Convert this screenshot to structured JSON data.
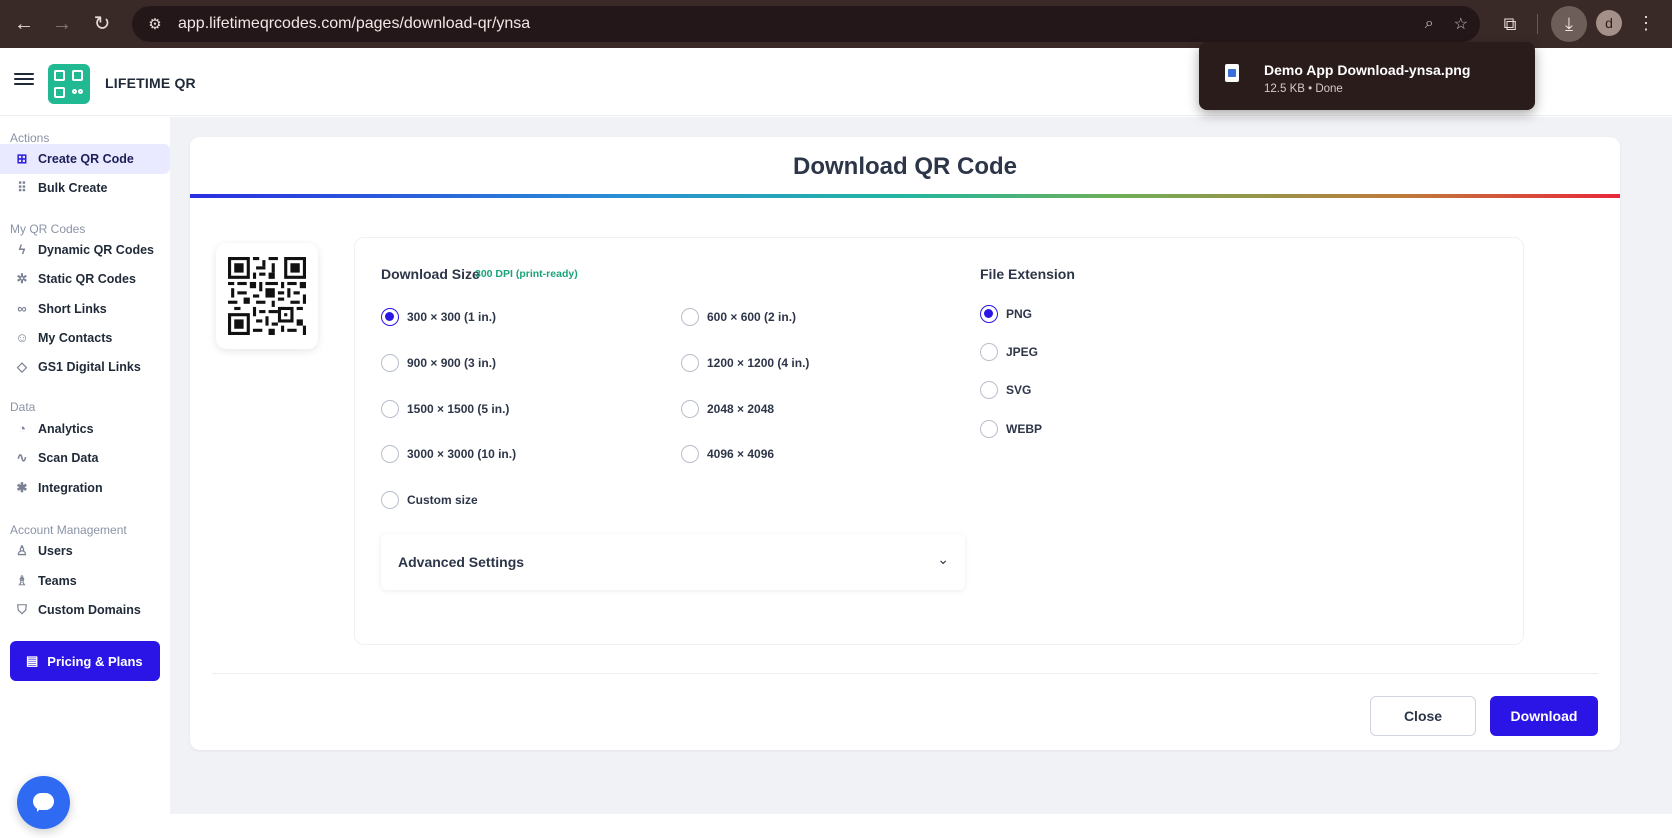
{
  "browser": {
    "url": "app.lifetimeqrcodes.com/pages/download-qr/ynsa",
    "profile_initial": "d"
  },
  "download_popup": {
    "filename": "Demo App Download-ynsa.png",
    "status": "12.5 KB • Done"
  },
  "app": {
    "brand": "LIFETIME QR",
    "accent": "#2a15e6",
    "logo_color": "#20b991"
  },
  "sidebar": {
    "sections": [
      {
        "label": "Actions",
        "items": [
          {
            "label": "Create QR Code",
            "icon": "plus-square-icon",
            "active": true
          },
          {
            "label": "Bulk Create",
            "icon": "grid-icon"
          }
        ]
      },
      {
        "label": "My QR Codes",
        "items": [
          {
            "label": "Dynamic QR Codes",
            "icon": "bolt-icon"
          },
          {
            "label": "Static QR Codes",
            "icon": "static-icon"
          },
          {
            "label": "Short Links",
            "icon": "link-icon"
          },
          {
            "label": "My Contacts",
            "icon": "contacts-icon"
          },
          {
            "label": "GS1 Digital Links",
            "icon": "tag-icon"
          }
        ]
      },
      {
        "label": "Data",
        "items": [
          {
            "label": "Analytics",
            "icon": "pie-chart-icon"
          },
          {
            "label": "Scan Data",
            "icon": "activity-icon"
          },
          {
            "label": "Integration",
            "icon": "bug-icon"
          }
        ]
      },
      {
        "label": "Account Management",
        "items": [
          {
            "label": "Users",
            "icon": "user-plus-icon"
          },
          {
            "label": "Teams",
            "icon": "users-icon"
          },
          {
            "label": "Custom Domains",
            "icon": "shield-icon"
          }
        ]
      }
    ],
    "pricing_label": "Pricing & Plans"
  },
  "dialog": {
    "title": "Download QR Code",
    "download_size_label": "Download Size",
    "dpi_note": "300 DPI (print-ready)",
    "sizes": [
      {
        "label": "300 × 300 (1 in.)",
        "checked": true
      },
      {
        "label": "600 × 600 (2 in.)",
        "checked": false
      },
      {
        "label": "900 × 900 (3 in.)",
        "checked": false
      },
      {
        "label": "1200 × 1200 (4 in.)",
        "checked": false
      },
      {
        "label": "1500 × 1500 (5 in.)",
        "checked": false
      },
      {
        "label": "2048 × 2048",
        "checked": false
      },
      {
        "label": "3000 × 3000 (10 in.)",
        "checked": false
      },
      {
        "label": "4096 × 4096",
        "checked": false
      },
      {
        "label": "Custom size",
        "checked": false
      }
    ],
    "file_extension_label": "File Extension",
    "extensions": [
      {
        "label": "PNG",
        "checked": true
      },
      {
        "label": "JPEG",
        "checked": false
      },
      {
        "label": "SVG",
        "checked": false
      },
      {
        "label": "WEBP",
        "checked": false
      }
    ],
    "advanced_settings_label": "Advanced Settings",
    "close_label": "Close",
    "download_label": "Download"
  }
}
